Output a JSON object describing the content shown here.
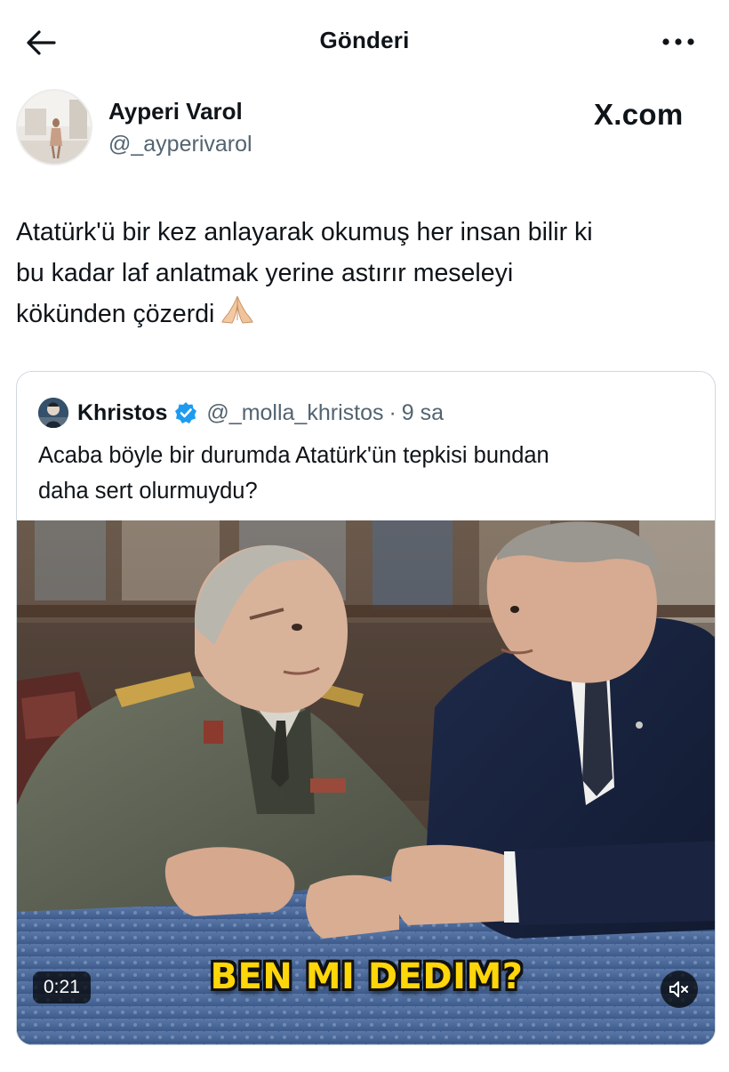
{
  "topbar": {
    "title": "Gönderi",
    "back_icon": "arrow-left-icon",
    "more_icon": "more-horizontal-icon"
  },
  "author": {
    "name": "Ayperi Varol",
    "handle": "@_ayperivarol",
    "watermark": "X.com"
  },
  "tweet": {
    "text_lines": [
      "Atatürk'ü bir kez anlayarak okumuş her insan bilir ki",
      "bu kadar laf anlatmak yerine astırır meseleyi",
      "kökünden çözerdi"
    ],
    "emoji": "🙏"
  },
  "quote": {
    "name": "Khristos",
    "handle": "@_molla_khristos",
    "separator": "·",
    "time": "9 sa",
    "text_lines": [
      "Acaba böyle bir durumda Atatürk'ün tepkisi bundan",
      "daha sert olurmuydu?"
    ],
    "verified_color": "#1d9bf0",
    "video": {
      "caption": "BEN MI DEDIM?",
      "timer": "0:21",
      "mute_icon": "volume-muted-icon"
    }
  }
}
